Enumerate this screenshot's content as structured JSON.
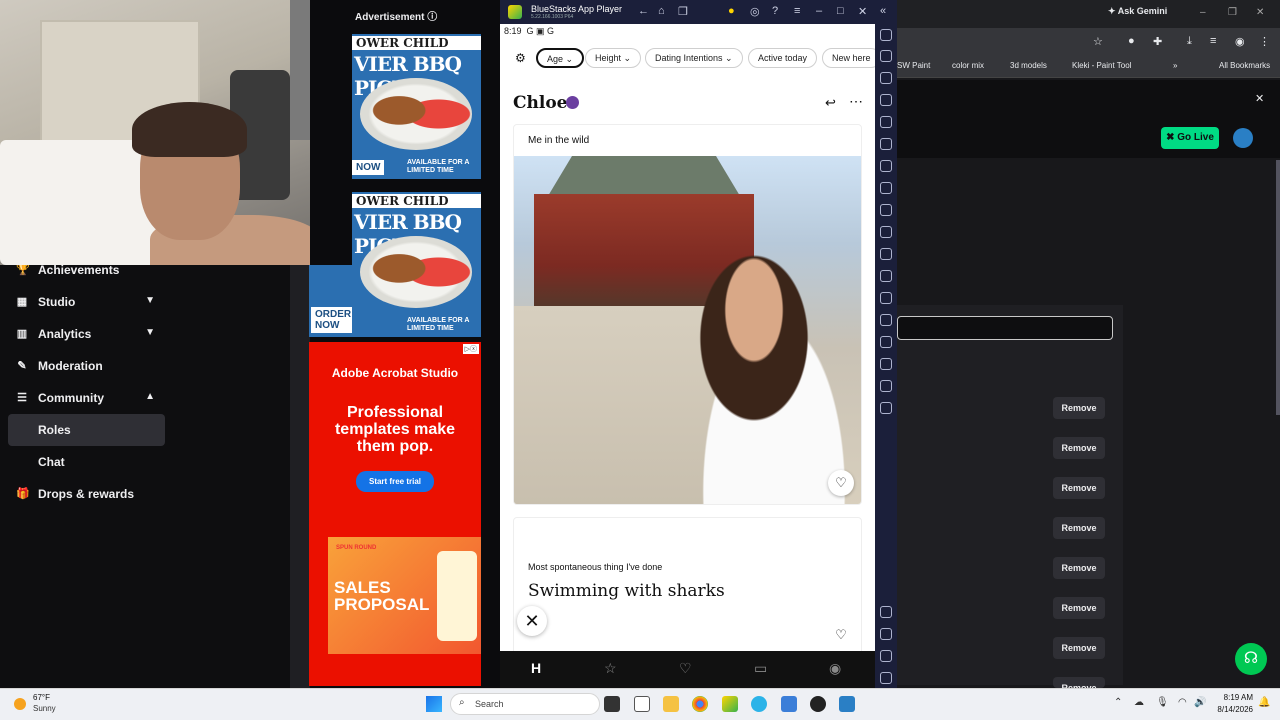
{
  "left_nav": {
    "items": [
      {
        "label": "Achievements",
        "icon": "trophy-icon"
      },
      {
        "label": "Studio",
        "icon": "studio-icon"
      },
      {
        "label": "Analytics",
        "icon": "analytics-icon"
      },
      {
        "label": "Moderation",
        "icon": "wrench-icon"
      },
      {
        "label": "Community",
        "icon": "community-icon"
      },
      {
        "label": "Roles"
      },
      {
        "label": "Chat"
      },
      {
        "label": "Drops & rewards",
        "icon": "gift-icon"
      }
    ]
  },
  "ads": {
    "label": "Advertisement",
    "bbq_brand": "OWER CHILD",
    "bbq_title": "VIER BBQ PICNIC",
    "bbq_now": "NOW",
    "bbq_order": "ORDER NOW",
    "bbq_avail": "AVAILABLE FOR A LIMITED TIME",
    "adobe_brand": "Adobe Acrobat Studio",
    "adobe_headline": "Professional templates make them pop.",
    "adobe_cta": "Start free trial",
    "sales_brand": "SPUN ROUND",
    "sales_title": "SALES PROPOSAL"
  },
  "bluestacks": {
    "title": "BlueStacks App Player",
    "version": "5.22.166.1003 P64",
    "time": "8:19"
  },
  "hinge": {
    "filters": [
      "Age",
      "Height",
      "Dating Intentions",
      "Active today",
      "New here"
    ],
    "name": "Chloe",
    "photo_prompt": "Me in the wild",
    "prompt_question": "Most spontaneous thing I've done",
    "prompt_answer": "Swimming with sharks"
  },
  "chrome": {
    "ask_gemini": "Ask Gemini",
    "bookmarks": [
      "SW Paint",
      "color mix",
      "3d models",
      "Kleki - Paint Tool",
      "All Bookmarks"
    ]
  },
  "twitch_right": {
    "go_live": "Go Live",
    "remove_label": "Remove",
    "remove_count": 8
  },
  "taskbar": {
    "weather_temp": "67°F",
    "weather_desc": "Sunny",
    "search_placeholder": "Search",
    "time": "8:19 AM",
    "date": "8/14/2026"
  }
}
